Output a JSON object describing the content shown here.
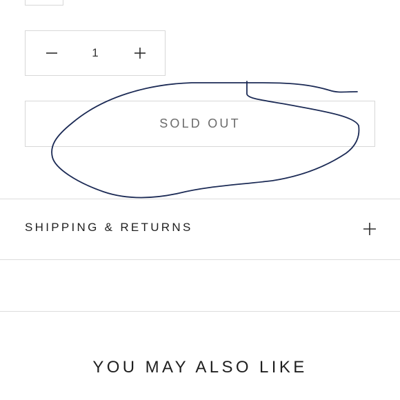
{
  "quantity": {
    "value": "1",
    "decrease_icon": "minus-icon",
    "increase_icon": "plus-icon"
  },
  "purchase": {
    "sold_out_label": "SOLD OUT"
  },
  "accordion": {
    "shipping_returns_label": "SHIPPING & RETURNS",
    "expand_icon": "plus-icon"
  },
  "recommendations": {
    "title": "YOU MAY ALSO LIKE"
  },
  "colors": {
    "border": "#d7d7d7",
    "text": "#1f1f1f",
    "muted_text": "#6b6b6b",
    "annotation_ink": "#1b2a55"
  }
}
